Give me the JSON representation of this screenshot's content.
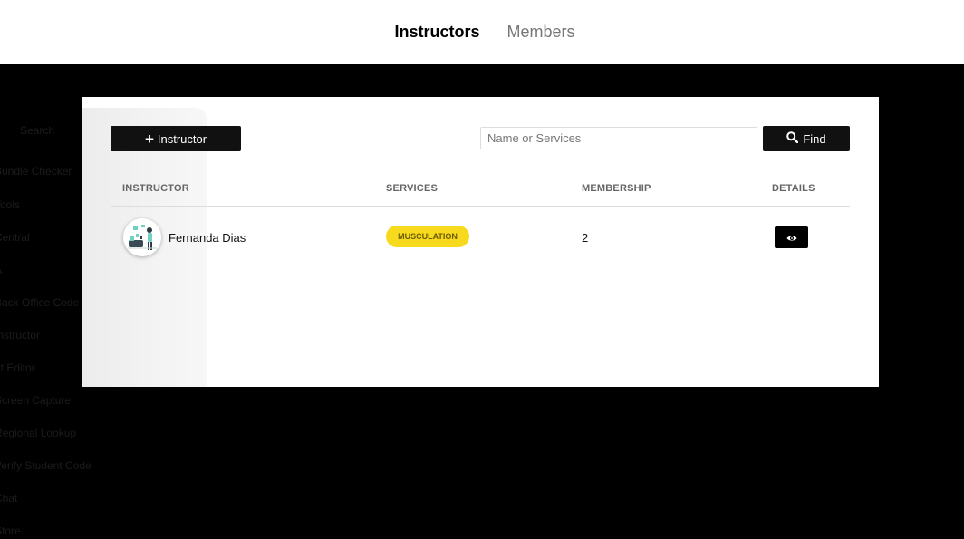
{
  "nav": {
    "links": [
      {
        "label": "Instructors",
        "active": true
      },
      {
        "label": "Members",
        "active": false
      }
    ]
  },
  "background_menu": {
    "items": [
      "Search",
      "Bundle Checker",
      "Tools",
      "Central",
      "A",
      "Back Office Code",
      "Instructor",
      "Lt Editor",
      "Screen Capture",
      "Regional Lookup",
      "Verify Student Code",
      "Chat",
      "Store"
    ]
  },
  "toolbar": {
    "add_label": "Instructor",
    "search_placeholder": "Name or Services",
    "search_value": "",
    "find_label": "Find"
  },
  "table": {
    "headers": [
      "INSTRUCTOR",
      "SERVICES",
      "MEMBERSHIP",
      "DETAILS"
    ],
    "rows": [
      {
        "name": "Fernanda Dias",
        "service": "MUSCULATION",
        "membership": "2"
      }
    ]
  },
  "colors": {
    "accent": "#f7da1e",
    "button": "#111111",
    "background": "#000000"
  },
  "icons": [
    "plus-icon",
    "search-icon",
    "eye-icon"
  ]
}
